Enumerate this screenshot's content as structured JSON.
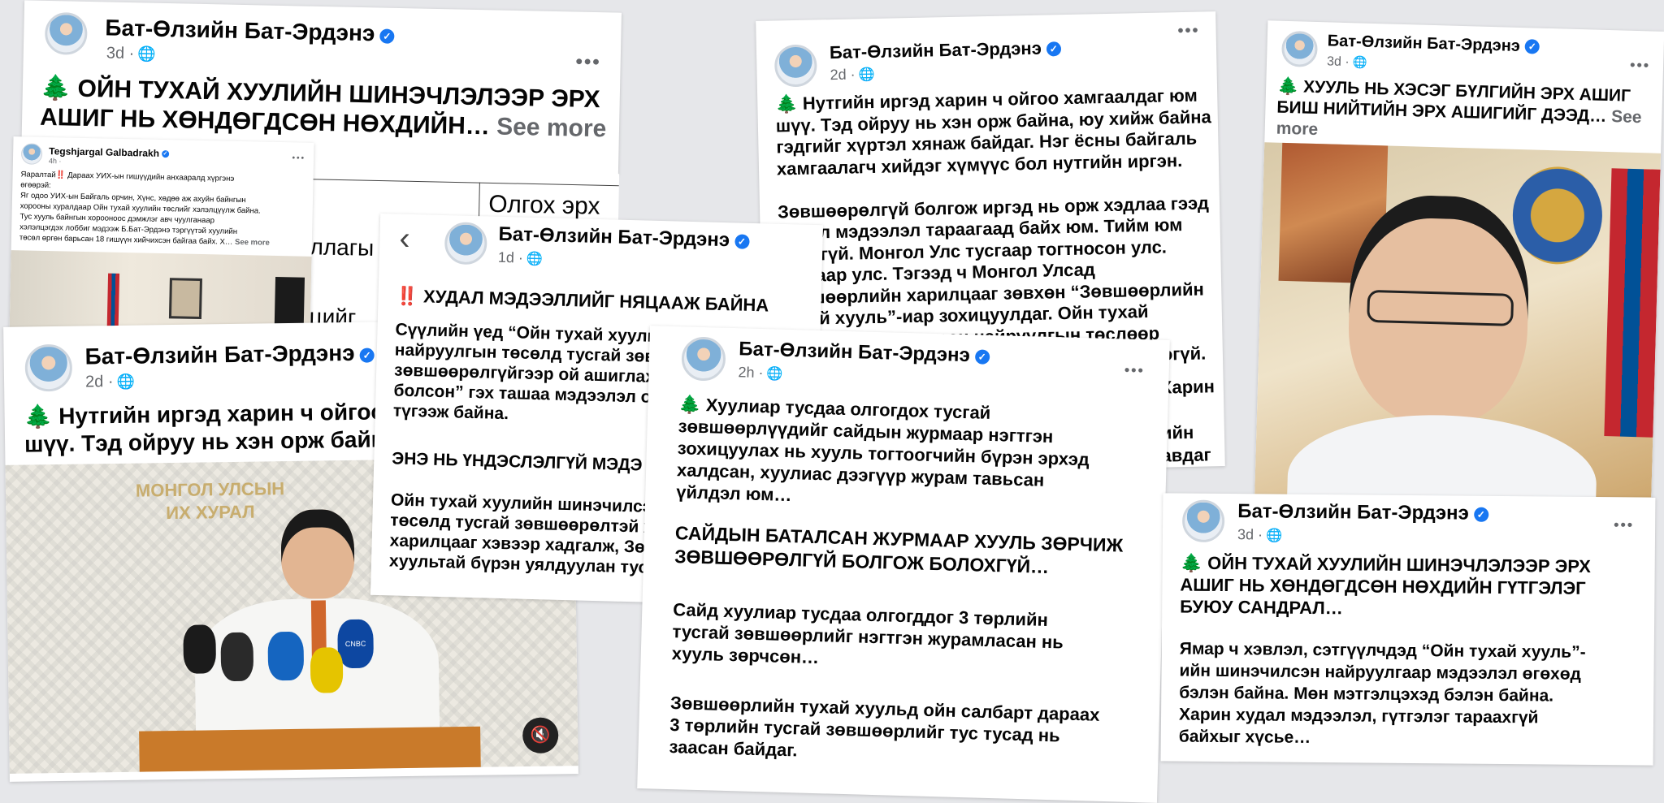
{
  "author": "Бат-Өлзийн Бат-Эрдэнэ",
  "verified_icon": "verified-badge-icon",
  "colors": {
    "background": "#e6e7ea",
    "verified": "#1877f2",
    "meta": "#65676b"
  },
  "see_more": "See more",
  "posts": {
    "p1": {
      "time": "3d ·",
      "text": "🌲 ОЙН ТУХАЙ ХУУЛИЙН ШИНЭЧЛЭЛЭЭР ЭРХ\nАШИГ НЬ ХӨНДӨГДСӨН НӨХДИЙН…"
    },
    "p1_embed": {
      "author": "Tegshjargal Galbadrakh",
      "time": "4h ·",
      "text": "Яаралтай‼️ Дараах УИХ-ын гишүүдийн анхааралд хүргэнэ\nөгөөрэй:\nЯг одоо УИХ-ын Байгаль орчин, Хүнс, хөдөө аж ахуйн байнгын\nхорооны хуралдаар Ойн тухай хуулийн төслийг хэлэлцүүлж байна.\nТус хууль байнгын хорооноос дэмжлэг авч чуулганаар\nхэлэлцэгдэх лоббиг мэдээж Б.Бат-Эрдэнэ тэргүүтэй хуулийн\nтөсөл өргөн барьсан 18 гишүүн хийчихсэн байгаа байх. Х…",
      "see_more": "See more"
    },
    "p1_table": {
      "col_header": "Олгох эрх",
      "row1": "уллагы",
      "row2": "эцийг"
    },
    "p2": {
      "time": "2d ·",
      "text": "🌲 Нутгийн иргэд харин ч ойгоо хамгаалдаг юм\nшүү. Тэд ойруу нь хэн орж байна, юу хийж байна\nгэдгийг хүртэл хянаж байдаг. Нэг ёсны байгаль\nхамгаалагч хийдэг хүмүүс бол нутгийн иргэн.\n\nЗөвшөөрөлгүй болгож иргэд нь орж хэдлаа гээд\nхудал мэдээлэл тараагаад байх юм. Тийм юм\nбайхгүй. Монгол Улс тусгаар тогтносон улс.\nТусгаар улс. Тэгээд ч Монгол Улсад\nзөвшөөрлийн харилцааг зөвхөн “Зөвшөөрлийн\nтухай хууль”-иар зохицуулдаг. Ойн тухай\nхуулийн шинэчилсэн найруулгын төслөөр\n“Зөвшөөрлийн тухай хууль”-ийг огт хөндөөгүй."
    },
    "p2_tail": {
      "l1": "Харин",
      "l2": "ийн",
      "l3": "авдаг",
      "l4": "цээд"
    },
    "p3": {
      "time": "3d ·",
      "text": "🌲 ХУУЛЬ НЬ ХЭСЭГ БҮЛГИЙН ЭРХ АШИГ\nБИШ НИЙТИЙН ЭРХ АШИГИЙГ ДЭЭД…"
    },
    "p4": {
      "time": "2d ·",
      "text": "🌲 Нутгийн иргэд харин ч ойгоо\nшүү. Тэд ойруу нь хэн орж байна"
    },
    "p4_photo": {
      "sign_line1": "МОНГОЛ УЛСЫН",
      "sign_line2": "ИХ ХУРАЛ",
      "mic_label": "CNBC"
    },
    "p5": {
      "time": "1d ·",
      "back": "‹",
      "headline": "‼️ ХУДАЛ МЭДЭЭЛЛИЙГ НЯЦААЖ БАЙНА",
      "para1": "Сүүлийн үед “Ойн тухай хуули\nнайруулгын төсөлд тусгай зөв\nзөвшөөрөлгүйгээр ой ашиглаx\nболсон” гэх ташаа мэдээлэл о\nтүгээж байна.",
      "para2": "ЭНЭ НЬ ҮНДЭСЛЭЛГҮЙ МЭДЭ",
      "para3": "Ойн тухай хуулийн шинэчилсэ\nтөсөлд тусгай зөвшөөрөлтэй х\nхарилцааг хэвээр хадгалж, Зө\nхуультай бүрэн уялдуулан тус"
    },
    "p6": {
      "time": "2h ·",
      "para1": "🌲 Хуулиар тусдаа олгогдох тусгай\nзөвшөөрлүүдийг сайдын журмаар нэгтгэн\nзохицуулах нь хууль тогтоогчийн бүрэн эрхэд\nхалдсан, хуулиас дээгүүр журам тавьсан\nүйлдэл юм…",
      "para2": "САЙДЫН БАТАЛСАН ЖУРМААР ХУУЛЬ ЗӨРЧИЖ\nЗӨВШӨӨРӨЛГҮЙ БОЛГОЖ БОЛОХГҮЙ…",
      "para3": "Сайд хуулиар тусдаа олгогддог 3 төрлийн\nтусгай зөвшөөрлийг нэгтгэн журамласан нь\nхууль зөрчсөн…",
      "para4": "Зөвшөөрлийн тухай хуульд ойн салбарт дараах\n3 төрлийн тусгай зөвшөөрлийг тус тусад нь\nзаасан байдаг."
    },
    "p7": {
      "time": "3d ·",
      "para1": "🌲 ОЙН ТУХАЙ ХУУЛИЙН ШИНЭЧЛЭЛЭЭР ЭРХ\nАШИГ НЬ ХӨНДӨГДСӨН НӨХДИЙН ГҮТГЭЛЭГ\nБУЮУ САНДРАЛ…",
      "para2": "Ямар ч хэвлэл, сэтгүүлчдэд “Ойн тухай хууль”-\nийн шинэчилсэн найруулгаар мэдээлэл өгөхөд\nбэлэн байна. Мөн мэтгэлцэхэд бэлэн байна.\nХарин худал мэдээлэл, гүтгэлэг тараахгүй\nбайхыг хүсье…"
    }
  }
}
